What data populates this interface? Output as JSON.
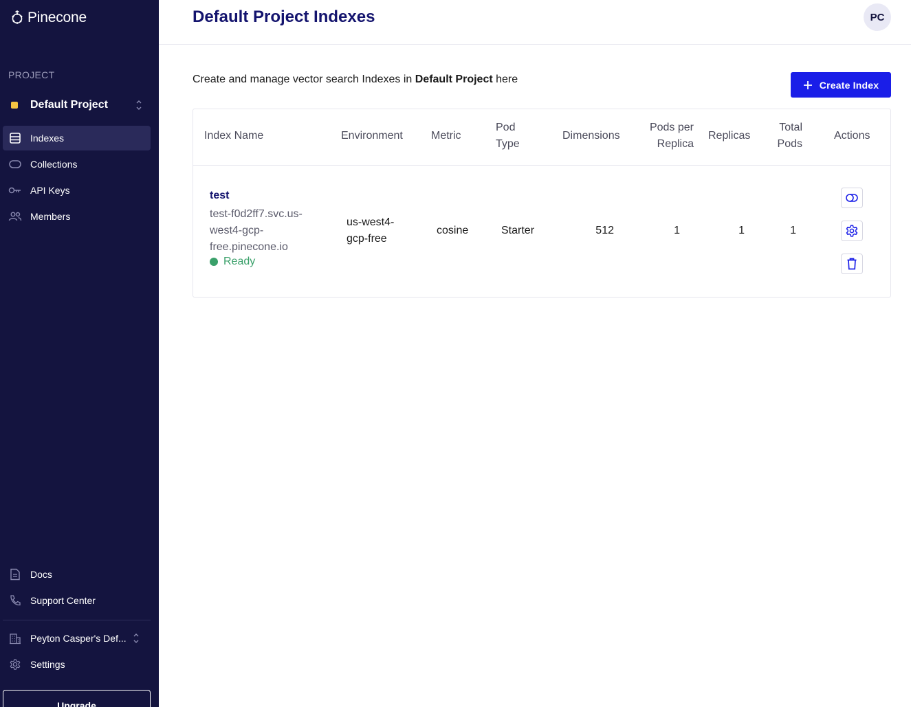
{
  "app": {
    "logo_text": "Pinecone"
  },
  "sidebar": {
    "section_label": "PROJECT",
    "project_name": "Default Project",
    "nav": [
      {
        "label": "Indexes",
        "icon": "list-icon",
        "active": true
      },
      {
        "label": "Collections",
        "icon": "toggle-icon",
        "active": false
      },
      {
        "label": "API Keys",
        "icon": "key-icon",
        "active": false
      },
      {
        "label": "Members",
        "icon": "people-icon",
        "active": false
      }
    ],
    "bottom": [
      {
        "label": "Docs",
        "icon": "document-icon"
      },
      {
        "label": "Support Center",
        "icon": "phone-icon"
      }
    ],
    "org_name": "Peyton Casper's Def...",
    "settings_label": "Settings",
    "upgrade_label": "Upgrade"
  },
  "header": {
    "title": "Default Project Indexes",
    "avatar_initials": "PC"
  },
  "main": {
    "intro_prefix": "Create and manage vector search Indexes in ",
    "intro_project": "Default Project",
    "intro_suffix": " here",
    "create_button": "Create Index",
    "table": {
      "headers": {
        "index_name": "Index Name",
        "environment": "Environment",
        "metric": "Metric",
        "pod_type_1": "Pod",
        "pod_type_2": "Type",
        "dimensions": "Dimensions",
        "pods_per_replica_1": "Pods per",
        "pods_per_replica_2": "Replica",
        "replicas": "Replicas",
        "total_pods_1": "Total",
        "total_pods_2": "Pods",
        "actions": "Actions"
      },
      "rows": [
        {
          "name": "test",
          "host": "test-f0d2ff7.svc.us-west4-gcp-free.pinecone.io",
          "status": "Ready",
          "environment_1": "us-west4-",
          "environment_2": "gcp-free",
          "metric": "cosine",
          "pod_type": "Starter",
          "dimensions": "512",
          "pods_per_replica": "1",
          "replicas": "1",
          "total_pods": "1"
        }
      ]
    }
  },
  "colors": {
    "sidebar_bg": "#14143f",
    "primary": "#1a1ee8",
    "title": "#14146e",
    "ready": "#3aa06a",
    "project_dot": "#f5c542"
  }
}
